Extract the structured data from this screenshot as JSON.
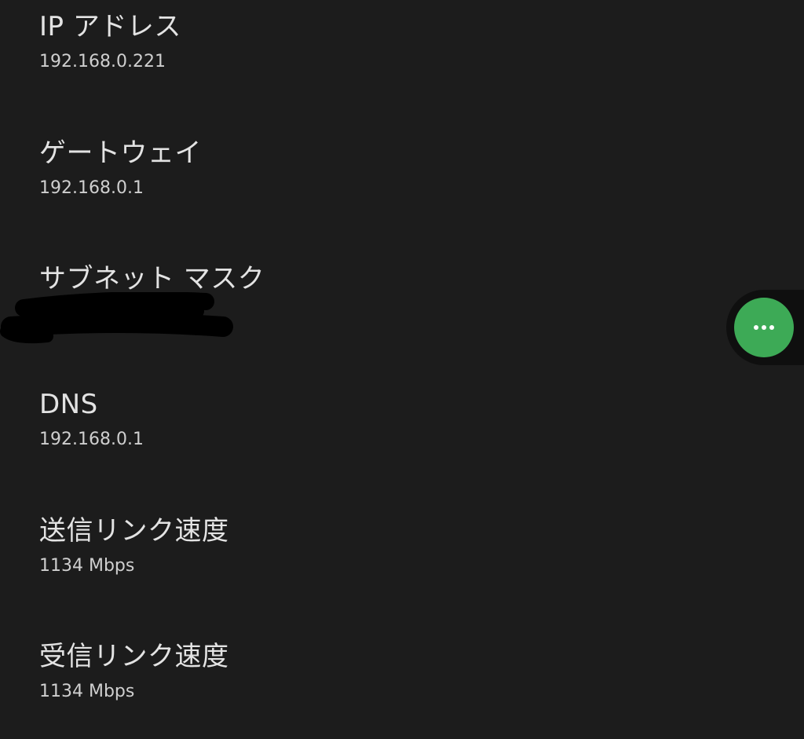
{
  "network_details": {
    "items": [
      {
        "title": "IP アドレス",
        "value": "192.168.0.221"
      },
      {
        "title": "ゲートウェイ",
        "value": "192.168.0.1"
      },
      {
        "title": "サブネット マスク",
        "value": ""
      },
      {
        "title": "DNS",
        "value": "192.168.0.1"
      },
      {
        "title": "送信リンク速度",
        "value": "1134 Mbps"
      },
      {
        "title": "受信リンク速度",
        "value": "1134 Mbps"
      }
    ]
  },
  "floating_button": {
    "icon": "more-horizontal-icon",
    "color": "#3daa56"
  },
  "colors": {
    "background": "#1c1c1c",
    "title_text": "#e3e3e3",
    "value_text": "#cfcfcf",
    "redaction": "#000000"
  }
}
